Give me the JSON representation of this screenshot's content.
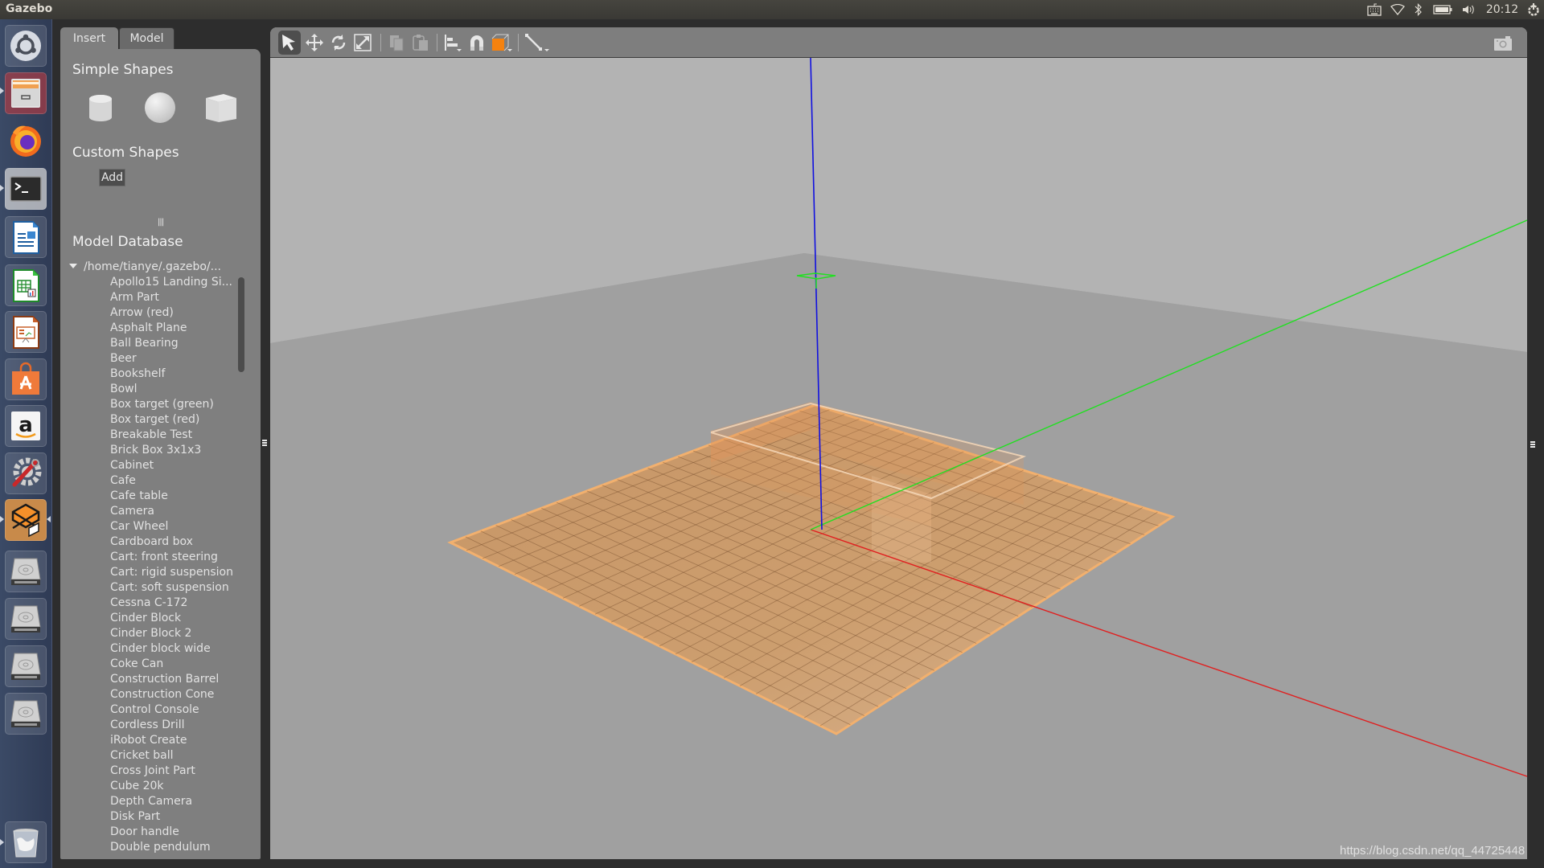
{
  "window": {
    "title": "Gazebo"
  },
  "tray": {
    "icons": [
      "keyboard-icon",
      "wifi-icon",
      "bluetooth-icon",
      "battery-icon",
      "volume-icon"
    ],
    "clock": "20:12",
    "power_icon": "power-gear-icon"
  },
  "launcher": {
    "items": [
      {
        "name": "ubuntu-dash",
        "icon": "ubuntu-logo-icon"
      },
      {
        "name": "files",
        "icon": "file-cabinet-icon"
      },
      {
        "name": "firefox",
        "icon": "firefox-icon"
      },
      {
        "name": "terminal",
        "icon": "terminal-icon"
      },
      {
        "name": "libreoffice-writer",
        "icon": "writer-icon"
      },
      {
        "name": "libreoffice-calc",
        "icon": "calc-icon"
      },
      {
        "name": "libreoffice-impress",
        "icon": "impress-icon"
      },
      {
        "name": "ubuntu-software",
        "icon": "software-bag-icon"
      },
      {
        "name": "amazon",
        "icon": "amazon-icon"
      },
      {
        "name": "system-settings",
        "icon": "settings-wrench-icon"
      },
      {
        "name": "gazebo",
        "icon": "gazebo-icon"
      },
      {
        "name": "drive-1",
        "icon": "hard-drive-icon"
      },
      {
        "name": "drive-2",
        "icon": "hard-drive-icon"
      },
      {
        "name": "drive-3",
        "icon": "hard-drive-icon"
      },
      {
        "name": "drive-4",
        "icon": "hard-drive-icon"
      },
      {
        "name": "trash",
        "icon": "trash-icon"
      }
    ]
  },
  "left_panel": {
    "tabs": [
      {
        "label": "Insert",
        "active": true
      },
      {
        "label": "Model",
        "active": false
      }
    ],
    "simple_shapes_title": "Simple Shapes",
    "simple_shapes": [
      "cylinder",
      "sphere",
      "box"
    ],
    "custom_shapes_title": "Custom Shapes",
    "add_label": "Add",
    "model_database_title": "Model Database",
    "tree_root": "/home/tianye/.gazebo/...",
    "models": [
      "Apollo15 Landing Si...",
      "Arm Part",
      "Arrow (red)",
      "Asphalt Plane",
      "Ball Bearing",
      "Beer",
      "Bookshelf",
      "Bowl",
      "Box target (green)",
      "Box target (red)",
      "Breakable Test",
      "Brick Box 3x1x3",
      "Cabinet",
      "Cafe",
      "Cafe table",
      "Camera",
      "Car Wheel",
      "Cardboard box",
      "Cart: front steering",
      "Cart: rigid suspension",
      "Cart: soft suspension",
      "Cessna C-172",
      "Cinder Block",
      "Cinder Block 2",
      "Cinder block wide",
      "Coke Can",
      "Construction Barrel",
      "Construction Cone",
      "Control Console",
      "Cordless Drill",
      "iRobot Create",
      "Cricket ball",
      "Cross Joint Part",
      "Cube 20k",
      "Depth Camera",
      "Disk Part",
      "Door handle",
      "Double pendulum"
    ]
  },
  "toolbar": {
    "tools": [
      {
        "name": "select-mode",
        "icon": "arrow-cursor-icon",
        "active": true
      },
      {
        "name": "translate-mode",
        "icon": "move-arrows-icon"
      },
      {
        "name": "rotate-mode",
        "icon": "rotate-icon"
      },
      {
        "name": "scale-mode",
        "icon": "scale-icon"
      },
      {
        "name": "copy",
        "icon": "copy-icon",
        "disabled": true
      },
      {
        "name": "paste",
        "icon": "paste-icon",
        "disabled": true
      },
      {
        "name": "align",
        "icon": "align-icon"
      },
      {
        "name": "snap",
        "icon": "magnet-icon"
      },
      {
        "name": "view-angle",
        "icon": "view-cube-icon"
      },
      {
        "name": "measure",
        "icon": "measure-line-icon"
      }
    ],
    "screenshot_icon": "camera-icon"
  },
  "scene": {
    "colors": {
      "sky": "#b3b3b3",
      "ground": "#a0a0a0",
      "x_axis": "#e02020",
      "y_axis": "#20e020",
      "z_axis": "#1010e0",
      "floor": "#d7a06a",
      "floor_edge": "#f2b06e"
    }
  },
  "watermark": "https://blog.csdn.net/qq_44725448"
}
